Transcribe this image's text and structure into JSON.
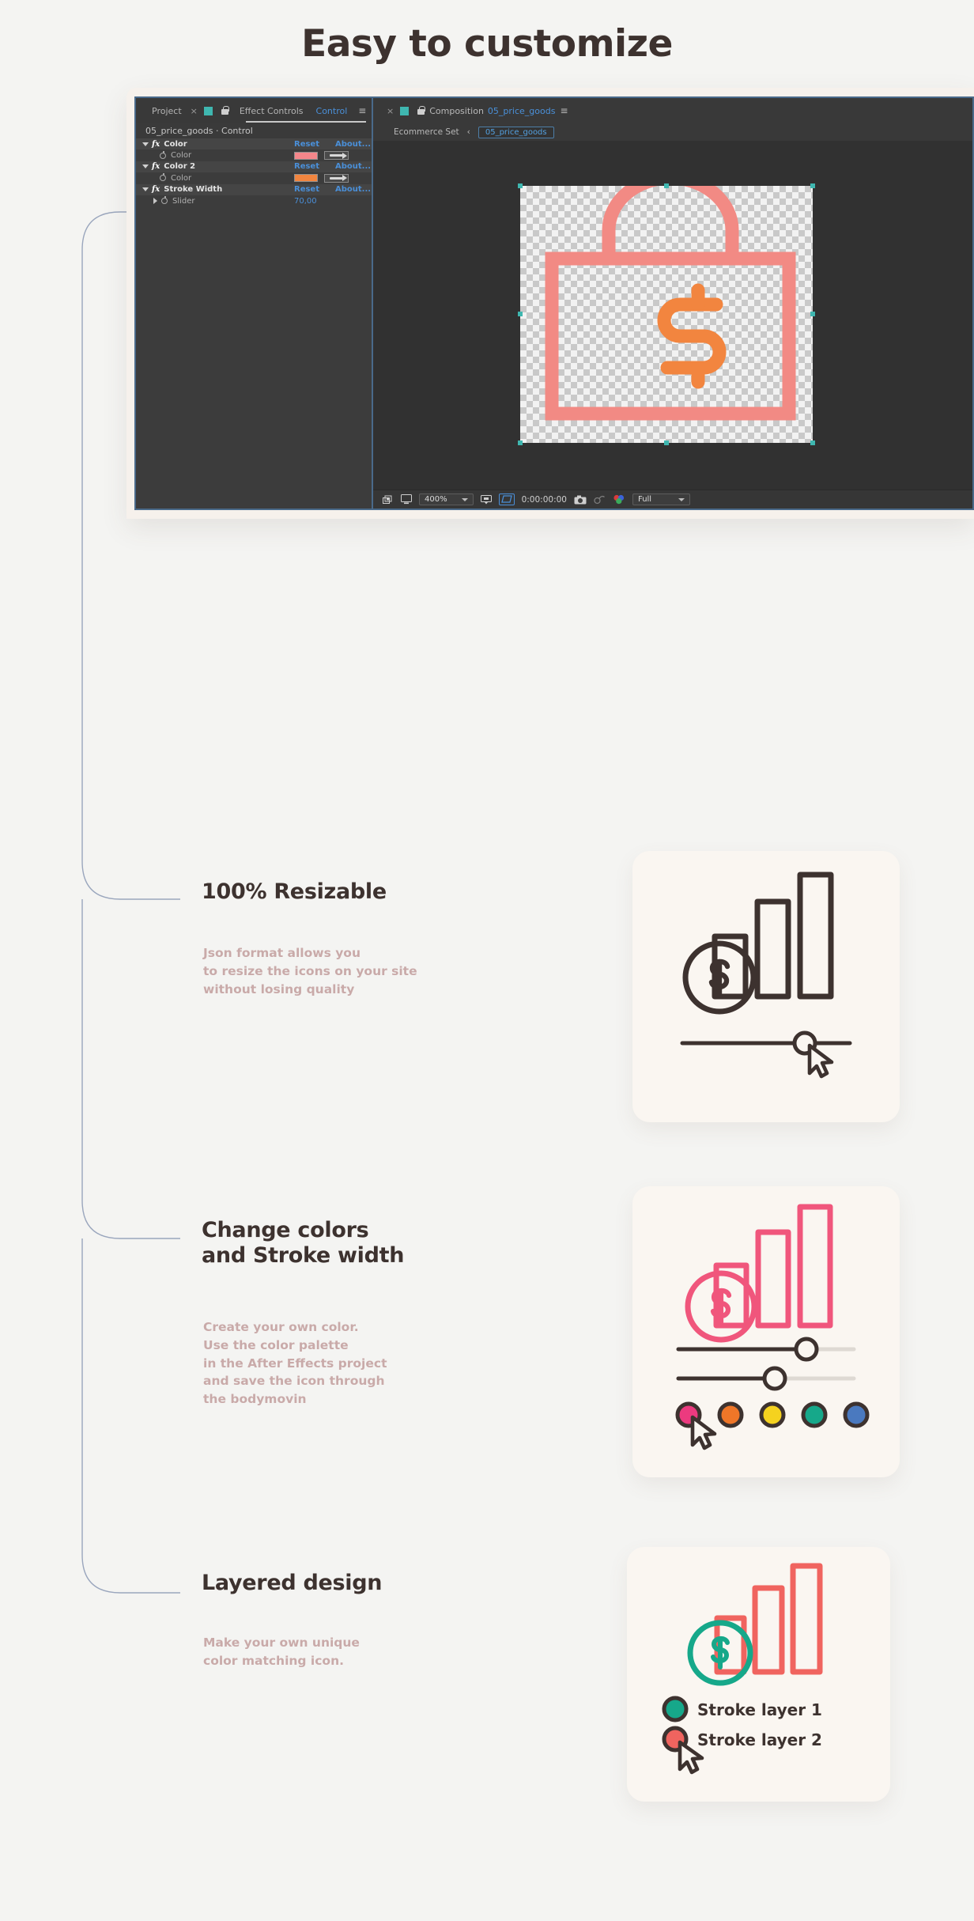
{
  "hero": {
    "title": "Easy to customize"
  },
  "ae": {
    "left_panel": {
      "tabs": [
        {
          "label": "Project",
          "active": false
        },
        {
          "label": "Effect Controls",
          "active": false
        },
        {
          "label": "Control",
          "active": true
        }
      ],
      "close_icon": "×",
      "menu_icon": "≡",
      "subtitle": "05_price_goods · Control",
      "effects": [
        {
          "name": "Color",
          "reset": "Reset",
          "about": "About...",
          "property": "Color",
          "swatch": "#f4868a",
          "value": null
        },
        {
          "name": "Color 2",
          "reset": "Reset",
          "about": "About...",
          "property": "Color",
          "swatch": "#f2853f",
          "value": null
        },
        {
          "name": "Stroke Width",
          "reset": "Reset",
          "about": "About...",
          "property": "Slider",
          "swatch": null,
          "value": "70,00"
        }
      ]
    },
    "comp_panel": {
      "close_icon": "×",
      "tab_prefix": "Composition",
      "tab_name": "05_price_goods",
      "menu_icon": "≡",
      "breadcrumb_root": "Ecommerce Set",
      "breadcrumb_sep": "‹",
      "breadcrumb_current": "05_price_goods",
      "bottom_bar": {
        "zoom": "400%",
        "timecode": "0:00:00:00",
        "quality": "Full"
      }
    }
  },
  "features": [
    {
      "title": "100% Resizable",
      "body": "Json format allows you\nto resize the icons on your site\nwithout losing quality"
    },
    {
      "title": "Change colors\nand Stroke width",
      "body": "Create your own color.\nUse the color palette\nin the After Effects project\nand save the icon through\nthe bodymovin"
    },
    {
      "title": "Layered design",
      "body": "Make your own unique\ncolor matching icon."
    }
  ],
  "cards": {
    "card1": {
      "slider_handle": true
    },
    "card2": {
      "palette": [
        "#ec3a7f",
        "#ef7628",
        "#f5d21f",
        "#16a88a",
        "#4a79bf"
      ]
    },
    "card3": {
      "legend": [
        {
          "label": "Stroke layer 1",
          "color": "#16a88a"
        },
        {
          "label": "Stroke layer 2",
          "color": "#f0645f"
        }
      ]
    }
  },
  "colors": {
    "bg": "#f4f4f2",
    "ink": "#3d322f",
    "muted_pink": "#c9aaa9",
    "card_bg": "#faf6f1",
    "coral": "#f0645f",
    "teal": "#16a88a"
  }
}
